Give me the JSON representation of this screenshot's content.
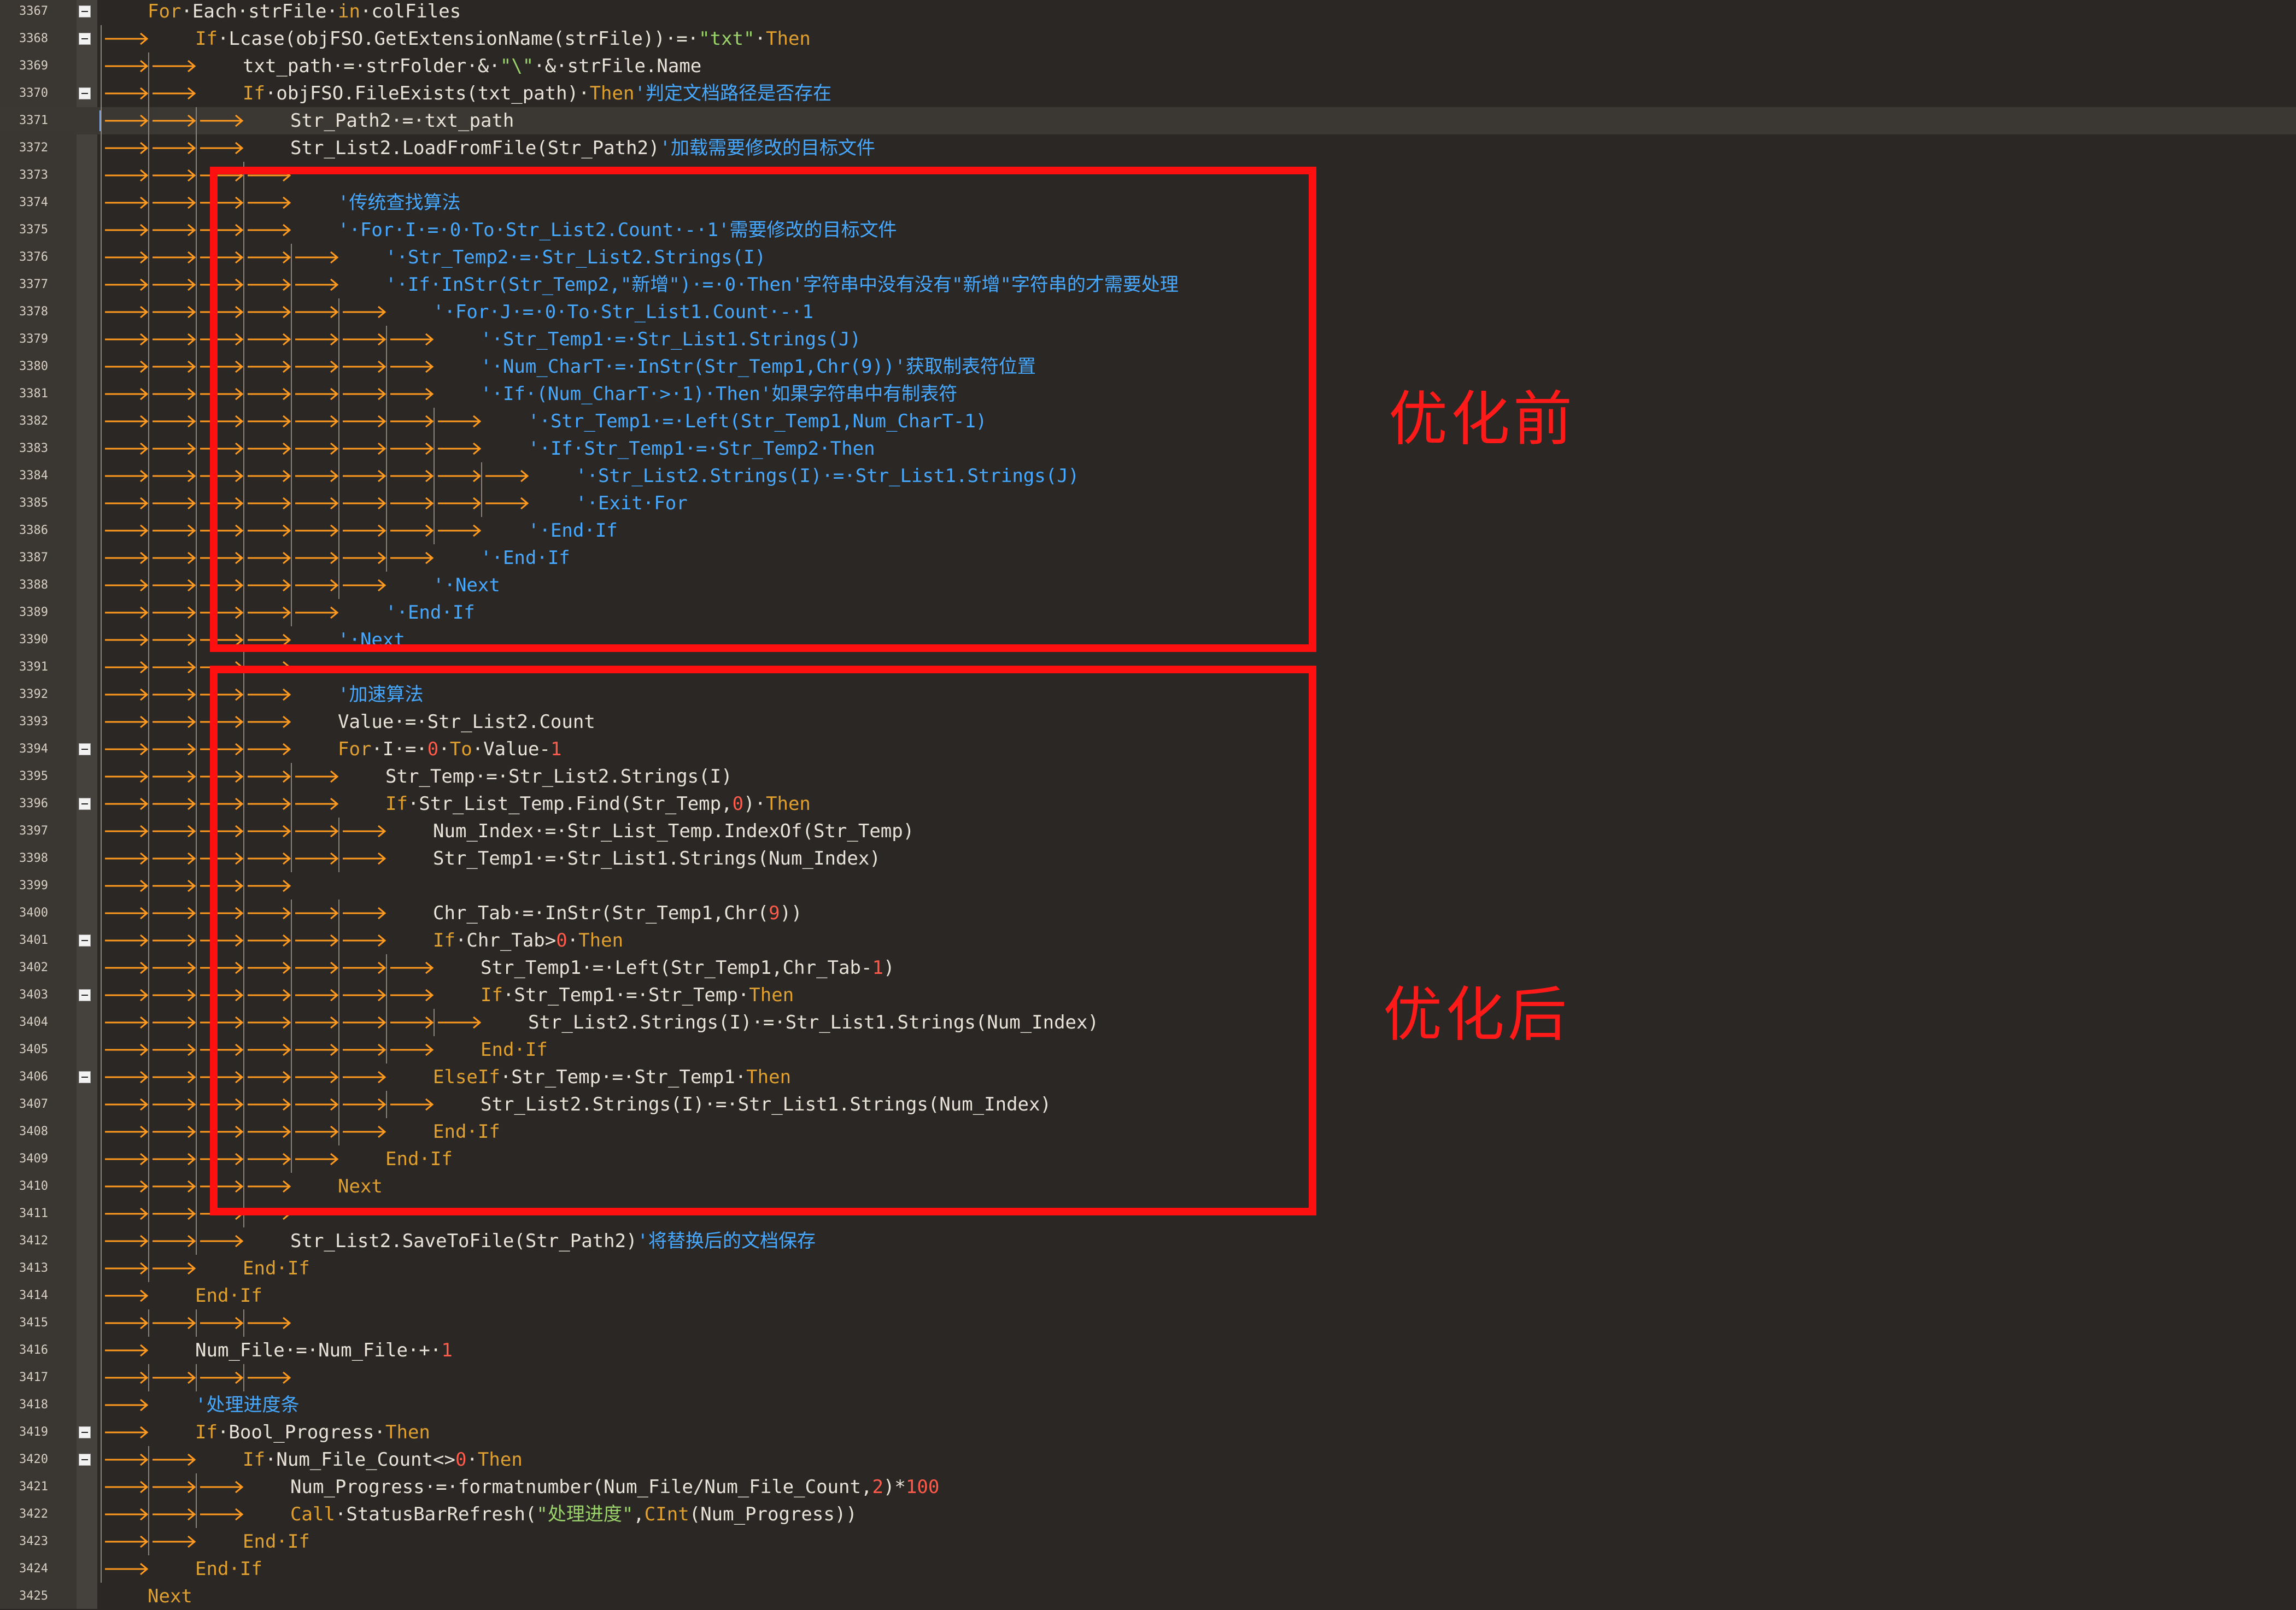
{
  "editor": {
    "lines": [
      {
        "n": "3367",
        "fold": true,
        "ind": 0,
        "seg": [
          [
            "For",
            "kw"
          ],
          [
            "·Each·strFile·",
            "def"
          ],
          [
            "in",
            "kw"
          ],
          [
            "·colFiles",
            "def"
          ]
        ]
      },
      {
        "n": "3368",
        "fold": true,
        "ind": 1,
        "seg": [
          [
            "If",
            "kw"
          ],
          [
            "·Lcase(objFSO.GetExtensionName(strFile))·=·",
            "def"
          ],
          [
            "\"txt\"",
            "str"
          ],
          [
            "·",
            "def"
          ],
          [
            "Then",
            "kw"
          ]
        ]
      },
      {
        "n": "3369",
        "ind": 2,
        "seg": [
          [
            "txt_path·=·strFolder·&·",
            "def"
          ],
          [
            "\"\\\"",
            "str"
          ],
          [
            "·&·strFile.Name",
            "def"
          ]
        ]
      },
      {
        "n": "3370",
        "fold": true,
        "ind": 2,
        "seg": [
          [
            "If",
            "kw"
          ],
          [
            "·objFSO.FileExists(txt_path)·",
            "def"
          ],
          [
            "Then",
            "kw"
          ],
          [
            "'判定文档路径是否存在",
            "cm"
          ]
        ]
      },
      {
        "n": "3371",
        "ind": 3,
        "cur": true,
        "seg": [
          [
            "Str_Path2·=·txt_path",
            "def"
          ]
        ]
      },
      {
        "n": "3372",
        "ind": 3,
        "seg": [
          [
            "Str_List2.LoadFromFile(Str_Path2)",
            "def"
          ],
          [
            "'加载需要修改的目标文件",
            "cm"
          ]
        ]
      },
      {
        "n": "3373",
        "ind": 0,
        "seg": []
      },
      {
        "n": "3374",
        "ind": 4,
        "seg": [
          [
            "'传统查找算法",
            "cm"
          ]
        ]
      },
      {
        "n": "3375",
        "ind": 4,
        "seg": [
          [
            "'·For·I·=·0·To·Str_List2.Count·-·1'需要修改的目标文件",
            "cm"
          ]
        ]
      },
      {
        "n": "3376",
        "ind": 5,
        "seg": [
          [
            "'·Str_Temp2·=·Str_List2.Strings(I)",
            "cm"
          ]
        ]
      },
      {
        "n": "3377",
        "ind": 5,
        "seg": [
          [
            "'·If·InStr(Str_Temp2,\"新增\")·=·0·Then'字符串中没有没有\"新增\"字符串的才需要处理",
            "cm"
          ]
        ]
      },
      {
        "n": "3378",
        "ind": 6,
        "seg": [
          [
            "'·For·J·=·0·To·Str_List1.Count·-·1",
            "cm"
          ]
        ]
      },
      {
        "n": "3379",
        "ind": 7,
        "seg": [
          [
            "'·Str_Temp1·=·Str_List1.Strings(J)",
            "cm"
          ]
        ]
      },
      {
        "n": "3380",
        "ind": 7,
        "seg": [
          [
            "'·Num_CharT·=·InStr(Str_Temp1,Chr(9))'获取制表符位置",
            "cm"
          ]
        ]
      },
      {
        "n": "3381",
        "ind": 7,
        "seg": [
          [
            "'·If·(Num_CharT·>·1)·Then'如果字符串中有制表符",
            "cm"
          ]
        ]
      },
      {
        "n": "3382",
        "ind": 8,
        "seg": [
          [
            "'·Str_Temp1·=·Left(Str_Temp1,Num_CharT-1)",
            "cm"
          ]
        ]
      },
      {
        "n": "3383",
        "ind": 8,
        "seg": [
          [
            "'·If·Str_Temp1·=·Str_Temp2·Then",
            "cm"
          ]
        ]
      },
      {
        "n": "3384",
        "ind": 9,
        "seg": [
          [
            "'·Str_List2.Strings(I)·=·Str_List1.Strings(J)",
            "cm"
          ]
        ]
      },
      {
        "n": "3385",
        "ind": 9,
        "seg": [
          [
            "'·Exit·For",
            "cm"
          ]
        ]
      },
      {
        "n": "3386",
        "ind": 8,
        "seg": [
          [
            "'·End·If",
            "cm"
          ]
        ]
      },
      {
        "n": "3387",
        "ind": 7,
        "seg": [
          [
            "'·End·If",
            "cm"
          ]
        ]
      },
      {
        "n": "3388",
        "ind": 6,
        "seg": [
          [
            "'·Next",
            "cm"
          ]
        ]
      },
      {
        "n": "3389",
        "ind": 5,
        "seg": [
          [
            "'·End·If",
            "cm"
          ]
        ]
      },
      {
        "n": "3390",
        "ind": 4,
        "seg": [
          [
            "'·Next",
            "cm"
          ]
        ]
      },
      {
        "n": "3391",
        "ind": 0,
        "seg": []
      },
      {
        "n": "3392",
        "ind": 4,
        "seg": [
          [
            "'加速算法",
            "cm"
          ]
        ]
      },
      {
        "n": "3393",
        "ind": 4,
        "seg": [
          [
            "Value·=·Str_List2.Count",
            "def"
          ]
        ]
      },
      {
        "n": "3394",
        "fold": true,
        "ind": 4,
        "seg": [
          [
            "For",
            "kw"
          ],
          [
            "·I·=·",
            "def"
          ],
          [
            "0",
            "num"
          ],
          [
            "·",
            "def"
          ],
          [
            "To",
            "kw"
          ],
          [
            "·Value-",
            "def"
          ],
          [
            "1",
            "num"
          ]
        ]
      },
      {
        "n": "3395",
        "ind": 5,
        "seg": [
          [
            "Str_Temp·=·Str_List2.Strings(I)",
            "def"
          ]
        ]
      },
      {
        "n": "3396",
        "fold": true,
        "ind": 5,
        "seg": [
          [
            "If",
            "kw"
          ],
          [
            "·Str_List_Temp.Find(Str_Temp,",
            "def"
          ],
          [
            "0",
            "num"
          ],
          [
            ")·",
            "def"
          ],
          [
            "Then",
            "kw"
          ]
        ]
      },
      {
        "n": "3397",
        "ind": 6,
        "seg": [
          [
            "Num_Index·=·Str_List_Temp.IndexOf(Str_Temp)",
            "def"
          ]
        ]
      },
      {
        "n": "3398",
        "ind": 6,
        "seg": [
          [
            "Str_Temp1·=·Str_List1.Strings(Num_Index)",
            "def"
          ]
        ]
      },
      {
        "n": "3399",
        "ind": 0,
        "seg": []
      },
      {
        "n": "3400",
        "ind": 6,
        "seg": [
          [
            "Chr_Tab·=·InStr(Str_Temp1,Chr(",
            "def"
          ],
          [
            "9",
            "num"
          ],
          [
            "))",
            "def"
          ]
        ]
      },
      {
        "n": "3401",
        "fold": true,
        "ind": 6,
        "seg": [
          [
            "If",
            "kw"
          ],
          [
            "·Chr_Tab>",
            "def"
          ],
          [
            "0",
            "num"
          ],
          [
            "·",
            "def"
          ],
          [
            "Then",
            "kw"
          ]
        ]
      },
      {
        "n": "3402",
        "ind": 7,
        "seg": [
          [
            "Str_Temp1·=·Left(Str_Temp1,Chr_Tab-",
            "def"
          ],
          [
            "1",
            "num"
          ],
          [
            ")",
            "def"
          ]
        ]
      },
      {
        "n": "3403",
        "fold": true,
        "ind": 7,
        "seg": [
          [
            "If",
            "kw"
          ],
          [
            "·Str_Temp1·=·Str_Temp·",
            "def"
          ],
          [
            "Then",
            "kw"
          ]
        ]
      },
      {
        "n": "3404",
        "ind": 8,
        "seg": [
          [
            "Str_List2.Strings(I)·=·Str_List1.Strings(Num_Index)",
            "def"
          ]
        ]
      },
      {
        "n": "3405",
        "ind": 7,
        "seg": [
          [
            "End·If",
            "kw"
          ]
        ]
      },
      {
        "n": "3406",
        "fold": true,
        "ind": 6,
        "seg": [
          [
            "ElseIf",
            "kw"
          ],
          [
            "·Str_Temp·=·Str_Temp1·",
            "def"
          ],
          [
            "Then",
            "kw"
          ]
        ]
      },
      {
        "n": "3407",
        "ind": 7,
        "seg": [
          [
            "Str_List2.Strings(I)·=·Str_List1.Strings(Num_Index)",
            "def"
          ]
        ]
      },
      {
        "n": "3408",
        "ind": 6,
        "seg": [
          [
            "End·If",
            "kw"
          ]
        ]
      },
      {
        "n": "3409",
        "ind": 5,
        "seg": [
          [
            "End·If",
            "kw"
          ]
        ]
      },
      {
        "n": "3410",
        "ind": 4,
        "seg": [
          [
            "Next",
            "kw"
          ]
        ]
      },
      {
        "n": "3411",
        "ind": 0,
        "seg": []
      },
      {
        "n": "3412",
        "ind": 3,
        "seg": [
          [
            "Str_List2.SaveToFile(Str_Path2)",
            "def"
          ],
          [
            "'将替换后的文档保存",
            "cm"
          ]
        ]
      },
      {
        "n": "3413",
        "ind": 2,
        "seg": [
          [
            "End·If",
            "kw"
          ]
        ]
      },
      {
        "n": "3414",
        "ind": 1,
        "seg": [
          [
            "End·If",
            "kw"
          ]
        ]
      },
      {
        "n": "3415",
        "ind": 0,
        "seg": []
      },
      {
        "n": "3416",
        "ind": 1,
        "seg": [
          [
            "Num_File·=·Num_File·+·",
            "def"
          ],
          [
            "1",
            "num"
          ]
        ]
      },
      {
        "n": "3417",
        "ind": 0,
        "seg": []
      },
      {
        "n": "3418",
        "ind": 1,
        "seg": [
          [
            "'处理进度条",
            "cm"
          ]
        ]
      },
      {
        "n": "3419",
        "fold": true,
        "ind": 1,
        "seg": [
          [
            "If",
            "kw"
          ],
          [
            "·Bool_Progress·",
            "def"
          ],
          [
            "Then",
            "kw"
          ]
        ]
      },
      {
        "n": "3420",
        "fold": true,
        "ind": 2,
        "seg": [
          [
            "If",
            "kw"
          ],
          [
            "·Num_File_Count<>",
            "def"
          ],
          [
            "0",
            "num"
          ],
          [
            "·",
            "def"
          ],
          [
            "Then",
            "kw"
          ]
        ]
      },
      {
        "n": "3421",
        "ind": 3,
        "seg": [
          [
            "Num_Progress·=·formatnumber(Num_File/Num_File_Count,",
            "def"
          ],
          [
            "2",
            "num"
          ],
          [
            ")*",
            "def"
          ],
          [
            "100",
            "num"
          ]
        ]
      },
      {
        "n": "3422",
        "ind": 3,
        "seg": [
          [
            "Call",
            "kw"
          ],
          [
            "·StatusBarRefresh(",
            "def"
          ],
          [
            "\"处理进度\"",
            "str"
          ],
          [
            ",",
            "def"
          ],
          [
            "CInt",
            "kw"
          ],
          [
            "(Num_Progress))",
            "def"
          ]
        ]
      },
      {
        "n": "3423",
        "ind": 2,
        "seg": [
          [
            "End·If",
            "kw"
          ]
        ]
      },
      {
        "n": "3424",
        "ind": 1,
        "seg": [
          [
            "End·If",
            "kw"
          ]
        ]
      },
      {
        "n": "3425",
        "ind": 0,
        "seg": [
          [
            "Next",
            "kw"
          ]
        ]
      }
    ]
  },
  "annotations": {
    "before_label": "优化前",
    "after_label": "优化后",
    "box_color": "#ff1010"
  },
  "colors": {
    "background": "#2b2724",
    "keyword": "#e0a030",
    "comment": "#46a8ff",
    "string": "#9ad36a",
    "number": "#ff5a4a",
    "default": "#e8e2d8",
    "tab_arrow": "#ff9a20"
  }
}
